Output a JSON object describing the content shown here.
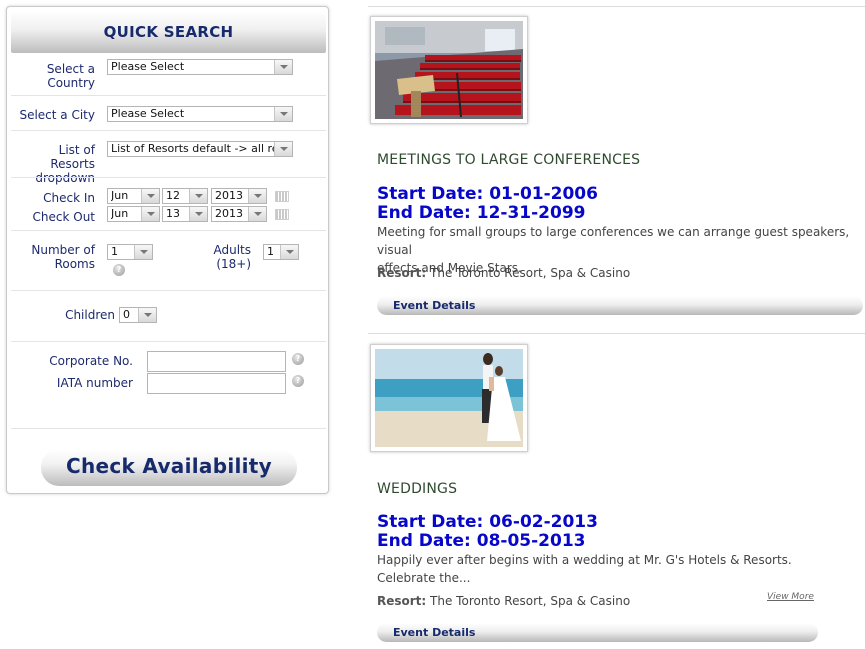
{
  "quick_search": {
    "title": "QUICK SEARCH",
    "country": {
      "label_line1": "Select a",
      "label_line2": "Country",
      "value": "Please Select"
    },
    "city": {
      "label": "Select a City",
      "value": "Please Select"
    },
    "resorts": {
      "label_line1": "List of Resorts",
      "label_line2": "dropdown",
      "value": "List of Resorts default -> all res"
    },
    "check_in": {
      "label": "Check In",
      "month": "Jun",
      "day": "12",
      "year": "2013"
    },
    "check_out": {
      "label": "Check Out",
      "month": "Jun",
      "day": "13",
      "year": "2013"
    },
    "rooms": {
      "label_line1": "Number of",
      "label_line2": "Rooms",
      "value": "1"
    },
    "adults": {
      "label": "Adults (18+)",
      "value": "1"
    },
    "children": {
      "label": "Children",
      "value": "0"
    },
    "corporate": {
      "label": "Corporate No.",
      "value": ""
    },
    "iata": {
      "label": "IATA number",
      "value": ""
    },
    "help_glyph": "?",
    "check_availability_label": "Check Availability"
  },
  "events": [
    {
      "photo_icon": "conference-room-photo",
      "title": "MEETINGS TO LARGE CONFERENCES",
      "start_date": "Start Date: 01-01-2006",
      "end_date": "End Date: 12-31-2099",
      "description_line1": "Meeting for small groups to large conferences we can arrange guest speakers, visual",
      "description_line2": "effects and Movie Stars.",
      "resort_label": "Resort:",
      "resort_value": "The Toronto Resort, Spa & Casino",
      "details_label": "Event Details"
    },
    {
      "photo_icon": "beach-wedding-photo",
      "title": "WEDDINGS",
      "start_date": "Start Date: 06-02-2013",
      "end_date": "End Date: 08-05-2013",
      "description_line1": "Happily ever after begins with a wedding at Mr. G's Hotels & Resorts.",
      "description_line2": "Celebrate the...",
      "resort_label": "Resort:",
      "resort_value": "The Toronto Resort, Spa & Casino",
      "view_more_label": "View More",
      "details_label": "Event Details"
    }
  ]
}
